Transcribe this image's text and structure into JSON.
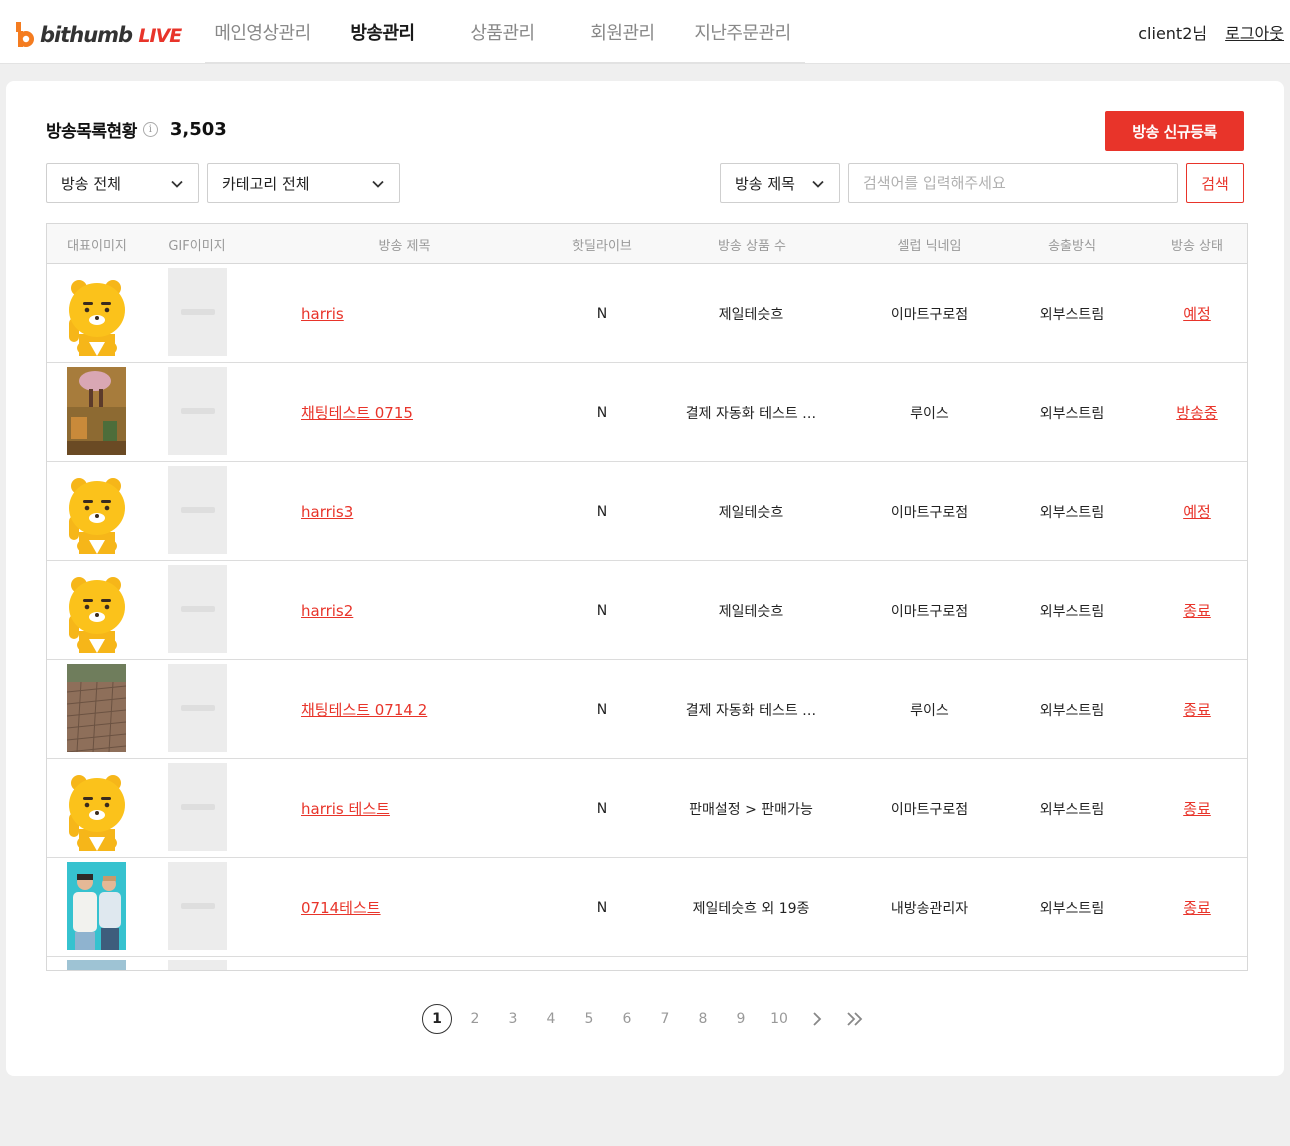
{
  "brand": {
    "name": "bithumb",
    "suffix": "LIVE",
    "accent": "#e8342a"
  },
  "nav": [
    {
      "label": "메인영상관리",
      "active": false
    },
    {
      "label": "방송관리",
      "active": true
    },
    {
      "label": "상품관리",
      "active": false
    },
    {
      "label": "회원관리",
      "active": false
    },
    {
      "label": "지난주문관리",
      "active": false
    }
  ],
  "user": {
    "greeting": "client2님",
    "logout": "로그아웃"
  },
  "main": {
    "title": "방송목록현황",
    "info_icon": "i",
    "count": "3,503",
    "new_button": "방송 신규등록",
    "filters": {
      "broadcast": "방송 전체",
      "category": "카테고리 전체",
      "search_field": "방송 제목"
    },
    "search": {
      "placeholder": "검색어를 입력해주세요",
      "value": "",
      "button": "검색"
    }
  },
  "table": {
    "headers": [
      "대표이미지",
      "GIF이미지",
      "방송 제목",
      "핫딜라이브",
      "방송 상품 수",
      "셀럽 닉네임",
      "송출방식",
      "방송 상태"
    ],
    "rows": [
      {
        "image": "ryan-character",
        "title": "harris",
        "hotdeal": "N",
        "products": "제일테슷흐",
        "celeb": "이마트구로점",
        "stream": "외부스트림",
        "status": "예정"
      },
      {
        "image": "illustration",
        "title": "채팅테스트 0715",
        "hotdeal": "N",
        "products": "결제 자동화 테스트 …",
        "celeb": "루이스",
        "stream": "외부스트림",
        "status": "방송중"
      },
      {
        "image": "ryan-character",
        "title": "harris3",
        "hotdeal": "N",
        "products": "제일테슷흐",
        "celeb": "이마트구로점",
        "stream": "외부스트림",
        "status": "예정"
      },
      {
        "image": "ryan-character",
        "title": "harris2",
        "hotdeal": "N",
        "products": "제일테슷흐",
        "celeb": "이마트구로점",
        "stream": "외부스트림",
        "status": "종료"
      },
      {
        "image": "brick-pavement",
        "title": "채팅테스트 0714 2",
        "hotdeal": "N",
        "products": "결제 자동화 테스트 …",
        "celeb": "루이스",
        "stream": "외부스트림",
        "status": "종료"
      },
      {
        "image": "ryan-character",
        "title": "harris 테스트",
        "hotdeal": "N",
        "products": "판매설정 > 판매가능",
        "celeb": "이마트구로점",
        "stream": "외부스트림",
        "status": "종료"
      },
      {
        "image": "fashion-photo",
        "title": "0714테스트",
        "hotdeal": "N",
        "products": "제일테슷흐  외 19종",
        "celeb": "내방송관리자",
        "stream": "외부스트림",
        "status": "종료"
      }
    ]
  },
  "pagination": {
    "pages": [
      "1",
      "2",
      "3",
      "4",
      "5",
      "6",
      "7",
      "8",
      "9",
      "10"
    ],
    "current": "1",
    "next_icon": "chevron-right",
    "last_icon": "double-chevron-right"
  }
}
